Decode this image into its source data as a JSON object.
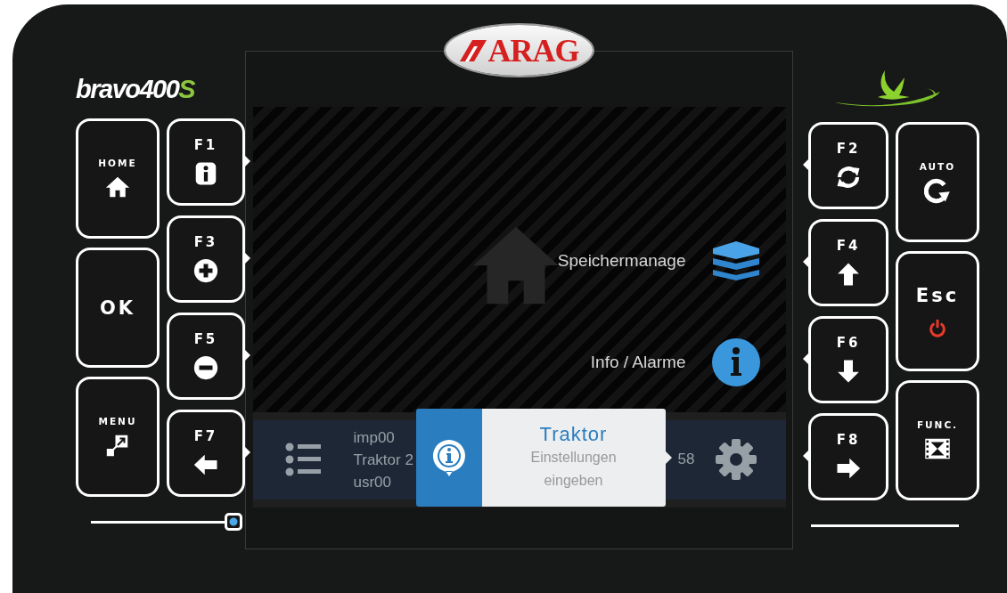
{
  "left_panel": {
    "model_logo": {
      "text": "bravo400",
      "suffix": "S"
    },
    "main_keys": [
      {
        "label": "HOME",
        "kind": "home"
      },
      {
        "label": "OK",
        "kind": "ok"
      },
      {
        "label": "MENU",
        "kind": "menu"
      }
    ],
    "function_keys": [
      {
        "label": "F1",
        "kind": "info"
      },
      {
        "label": "F3",
        "kind": "plus"
      },
      {
        "label": "F5",
        "kind": "minus"
      },
      {
        "label": "F7",
        "kind": "left"
      }
    ],
    "slider": {
      "level": 1
    }
  },
  "brand_logo": "ARAG",
  "screen": {
    "menu_items": [
      {
        "label": "Speichermanage",
        "kind": "layers"
      },
      {
        "label": "Info / Alarme",
        "kind": "info"
      }
    ],
    "status_bar": {
      "lines": [
        "imp00",
        "Traktor 2",
        "usr00"
      ],
      "value": "58"
    },
    "toast": {
      "title": "Traktor",
      "message": "Einstellungen eingeben"
    }
  },
  "right_panel": {
    "function_keys": [
      {
        "label": "F2",
        "kind": "sync"
      },
      {
        "label": "F4",
        "kind": "up"
      },
      {
        "label": "F6",
        "kind": "down"
      },
      {
        "label": "F8",
        "kind": "right"
      }
    ],
    "main_keys": [
      {
        "label": "AUTO",
        "kind": "auto"
      },
      {
        "label": "Esc",
        "kind": "power"
      },
      {
        "label": "FUNC.",
        "kind": "film"
      }
    ]
  }
}
